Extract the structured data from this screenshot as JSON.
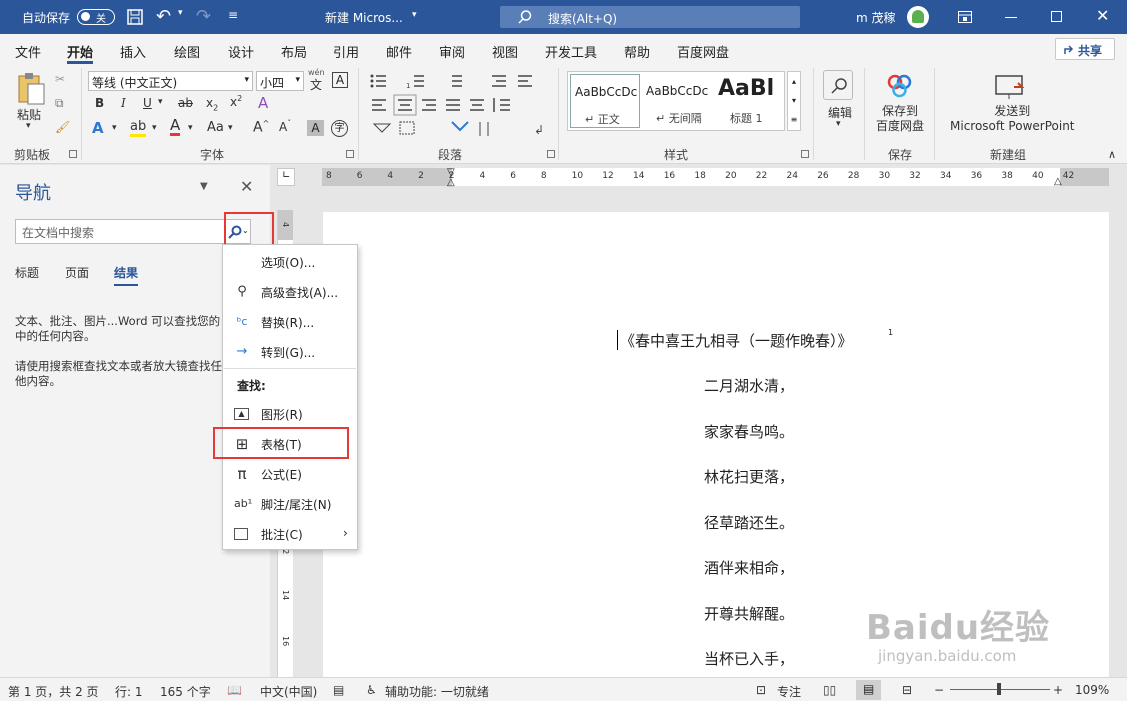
{
  "titlebar": {
    "autosave": "自动保存",
    "toggle": "关",
    "doc_title": "新建 Micros...",
    "search": "搜索(Alt+Q)",
    "user": "m 茂稼"
  },
  "menu": [
    "文件",
    "开始",
    "插入",
    "绘图",
    "设计",
    "布局",
    "引用",
    "邮件",
    "审阅",
    "视图",
    "开发工具",
    "帮助",
    "百度网盘"
  ],
  "share": "共享",
  "ribbon": {
    "clipboard": {
      "paste": "粘贴",
      "label": "剪贴板"
    },
    "font": {
      "name": "等线 (中文正文)",
      "size": "小四",
      "wen": "wén",
      "label": "字体"
    },
    "paragraph": {
      "label": "段落"
    },
    "styles": {
      "label": "样式",
      "items": [
        {
          "preview": "AaBbCcDc",
          "name": "↵ 正文"
        },
        {
          "preview": "AaBbCcDc",
          "name": "↵ 无间隔"
        },
        {
          "preview": "AaBl",
          "name": "标题 1"
        }
      ]
    },
    "editing": {
      "label": "编辑"
    },
    "save": {
      "button": "保存到\n百度网盘",
      "label": "保存"
    },
    "newgroup": {
      "button": "发送到\nMicrosoft PowerPoint",
      "label": "新建组"
    }
  },
  "nav": {
    "title": "导航",
    "search_placeholder": "在文档中搜索",
    "tabs": [
      "标题",
      "页面",
      "结果"
    ],
    "msg1a": "文本、批注、图片...Word 可以查找您的",
    "msg1b": "中的任何内容。",
    "msg2a": "请使用搜索框查找文本或者放大镜查找任",
    "msg2b": "他内容。"
  },
  "dropdown": {
    "items": [
      "选项(O)...",
      "高级查找(A)...",
      "替换(R)...",
      "转到(G)..."
    ],
    "section": "查找:",
    "find_items": [
      "图形(R)",
      "表格(T)",
      "公式(E)",
      "脚注/尾注(N)",
      "批注(C)"
    ]
  },
  "ruler": [
    "8",
    "6",
    "4",
    "2",
    "2",
    "4",
    "6",
    "8",
    "10",
    "12",
    "14",
    "16",
    "18",
    "20",
    "22",
    "24",
    "26",
    "28",
    "30",
    "32",
    "34",
    "36",
    "38",
    "40",
    "42"
  ],
  "document": {
    "title": "《春中喜王九相寻（一题作晚春）》",
    "footnote": "1",
    "lines": [
      "二月湖水清，",
      "家家春鸟鸣。",
      "林花扫更落，",
      "径草踏还生。",
      "酒伴来相命，",
      "开尊共解醒。",
      "当杯已入手，"
    ]
  },
  "status": {
    "page": "第 1 页，共 2 页",
    "line": "行: 1",
    "words": "165 个字",
    "lang": "中文(中国)",
    "access": "辅助功能: 一切就绪",
    "focus": "专注",
    "zoom": "109%"
  },
  "watermark": {
    "logo": "Baidu经验",
    "url": "jingyan.baidu.com"
  }
}
